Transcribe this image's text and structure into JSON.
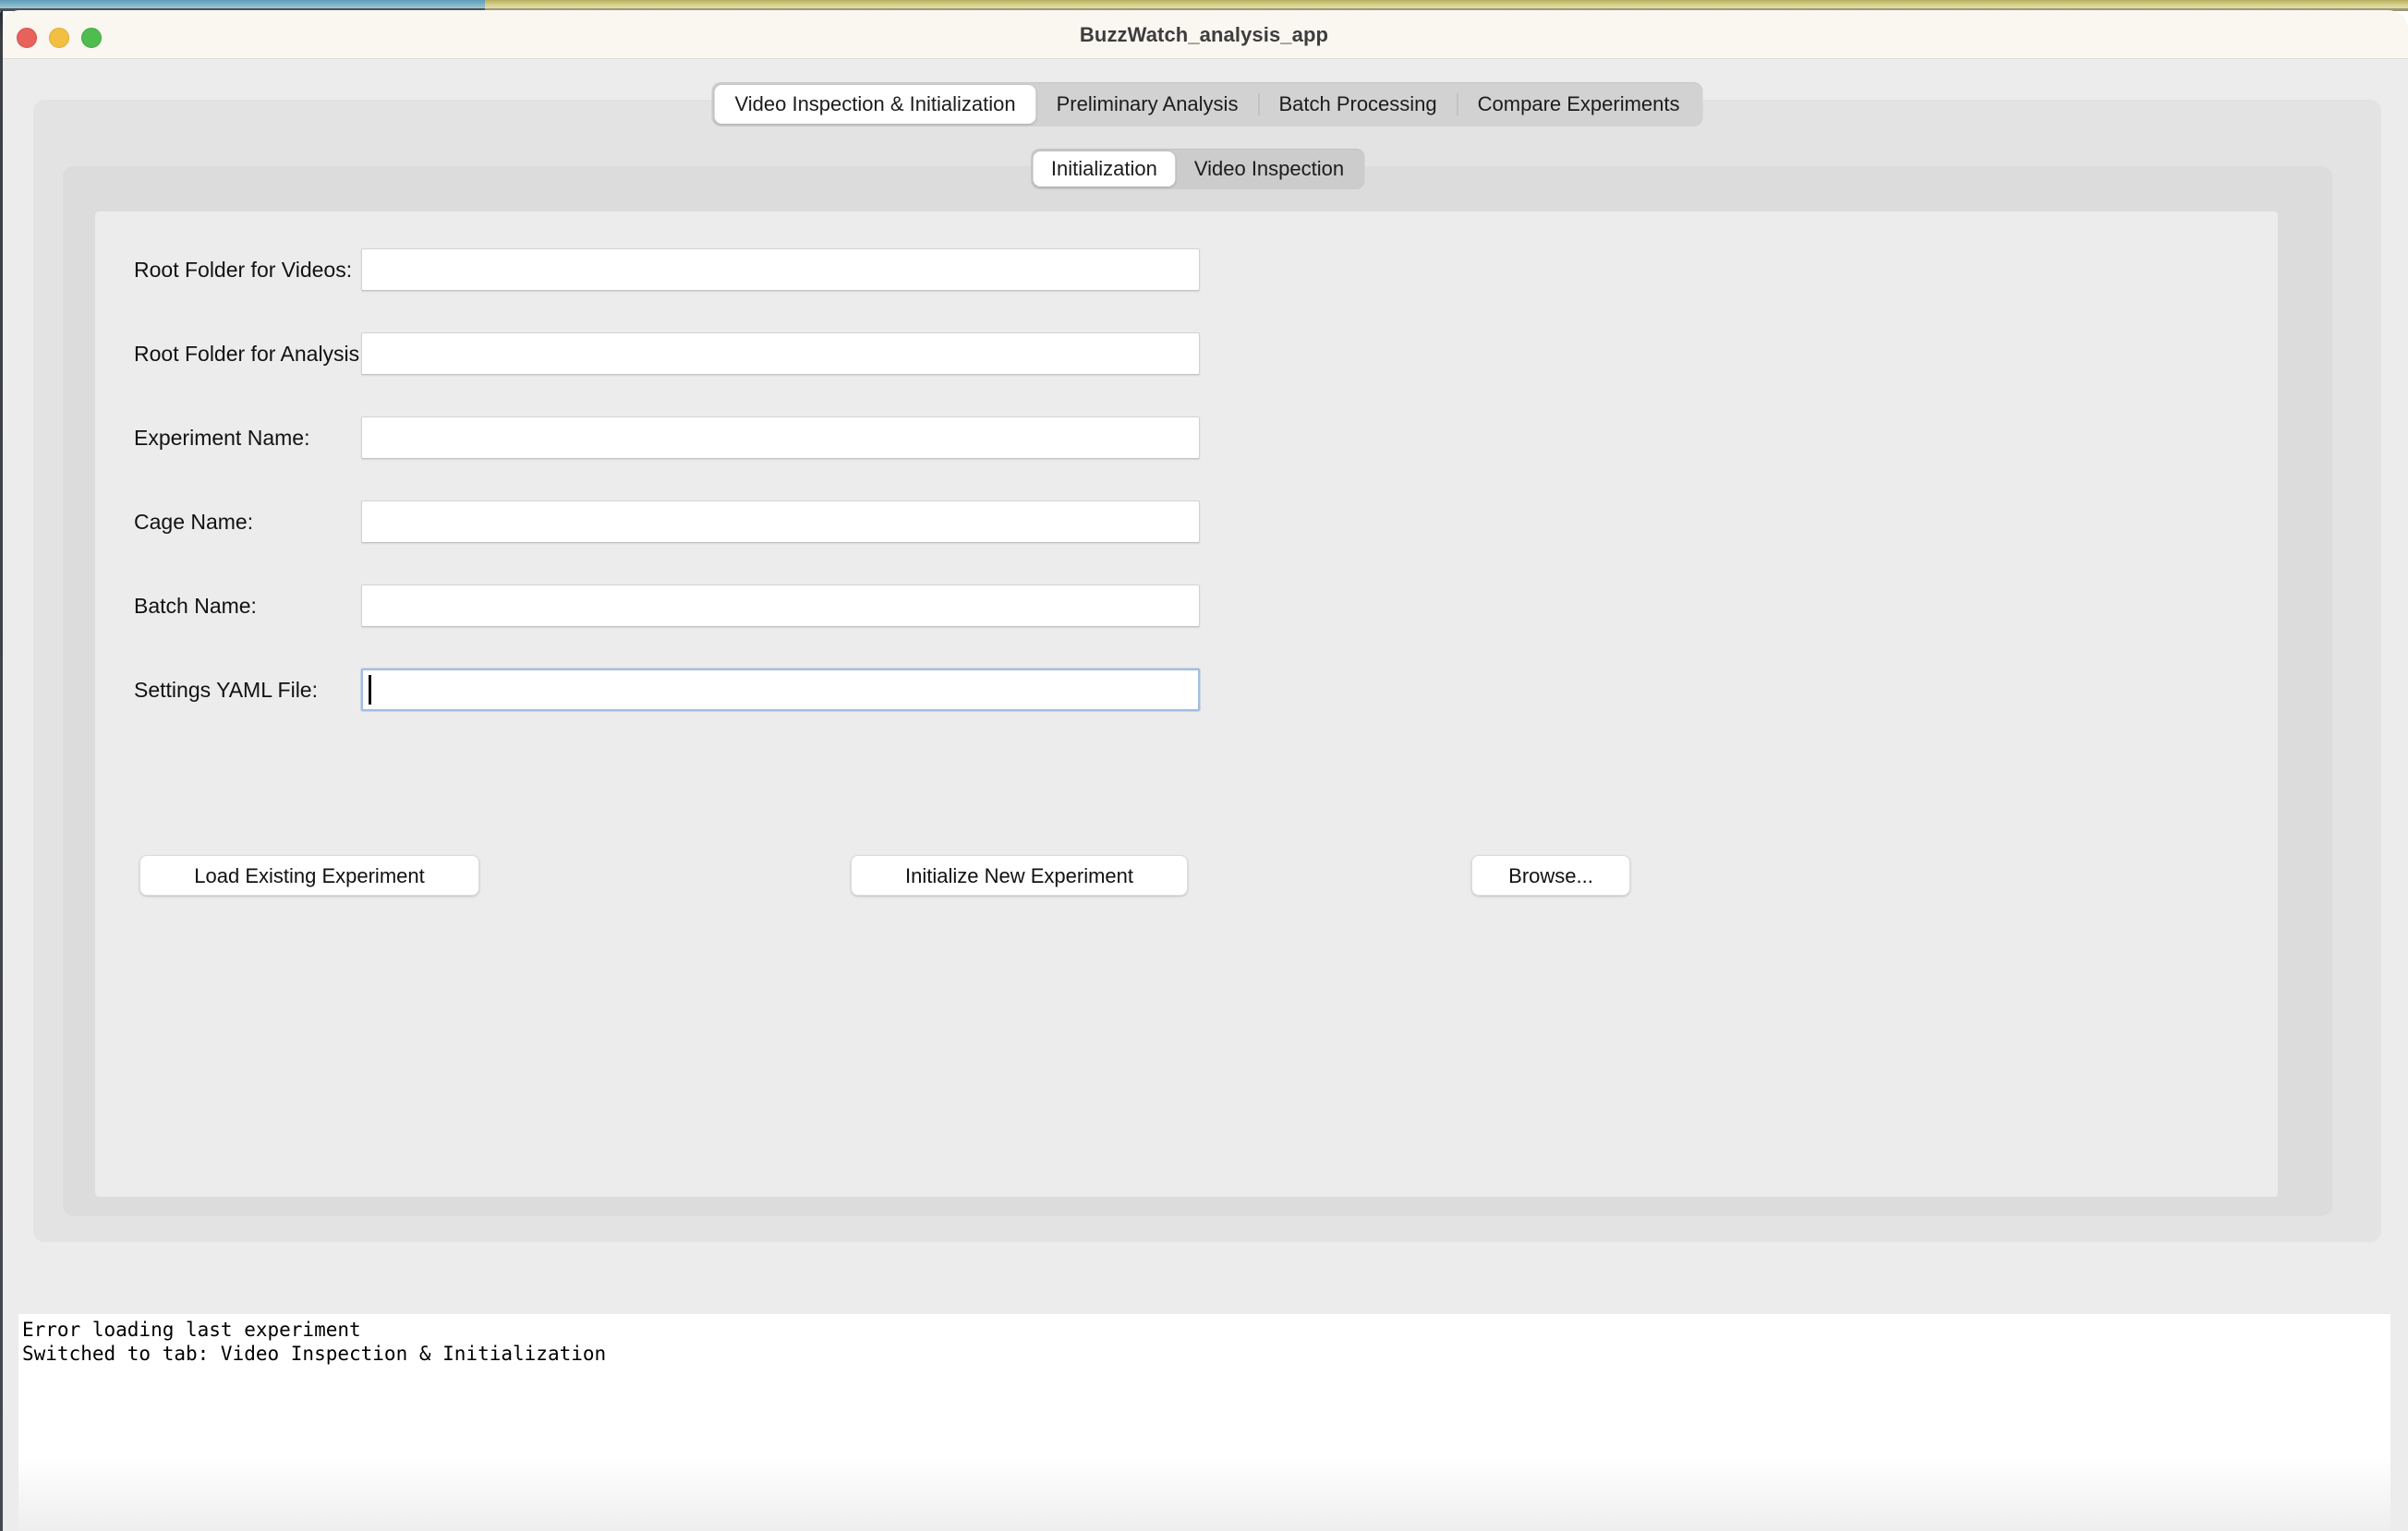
{
  "window": {
    "title": "BuzzWatch_analysis_app",
    "traffic_lights": [
      {
        "name": "close-button",
        "color": "#e8615a"
      },
      {
        "name": "minimize-button",
        "color": "#f2bf42"
      },
      {
        "name": "maximize-button",
        "color": "#4fbc4f"
      }
    ]
  },
  "main_tabs": [
    {
      "label": "Video Inspection & Initialization",
      "active": true
    },
    {
      "label": "Preliminary Analysis",
      "active": false
    },
    {
      "label": "Batch Processing",
      "active": false
    },
    {
      "label": "Compare Experiments",
      "active": false
    }
  ],
  "sub_tabs": [
    {
      "label": "Initialization",
      "active": true
    },
    {
      "label": "Video Inspection",
      "active": false
    }
  ],
  "form": {
    "fields": [
      {
        "label": "Root Folder for Videos:",
        "value": "",
        "placeholder": "",
        "focused": false
      },
      {
        "label": "Root Folder for Analysis:",
        "value": "",
        "placeholder": "",
        "focused": false
      },
      {
        "label": "Experiment Name:",
        "value": "",
        "placeholder": "",
        "focused": false
      },
      {
        "label": "Cage Name:",
        "value": "",
        "placeholder": "",
        "focused": false
      },
      {
        "label": "Batch Name:",
        "value": "",
        "placeholder": "",
        "focused": false
      },
      {
        "label": "Settings YAML File:",
        "value": "",
        "placeholder": "",
        "focused": true
      }
    ]
  },
  "buttons": {
    "load_existing": "Load Existing Experiment",
    "initialize_new": "Initialize New Experiment",
    "browse": "Browse..."
  },
  "console": {
    "lines": [
      "Error loading last experiment",
      "Switched to tab: Video Inspection & Initialization"
    ],
    "text": "Error loading last experiment\nSwitched to tab: Video Inspection & Initialization"
  },
  "colors": {
    "focus_ring": "#a3bde0",
    "window_background": "#ececec",
    "titlebar_background": "#faf6f0",
    "accent_left": "#7fb4c6",
    "accent_right": "#d6cf8c"
  }
}
